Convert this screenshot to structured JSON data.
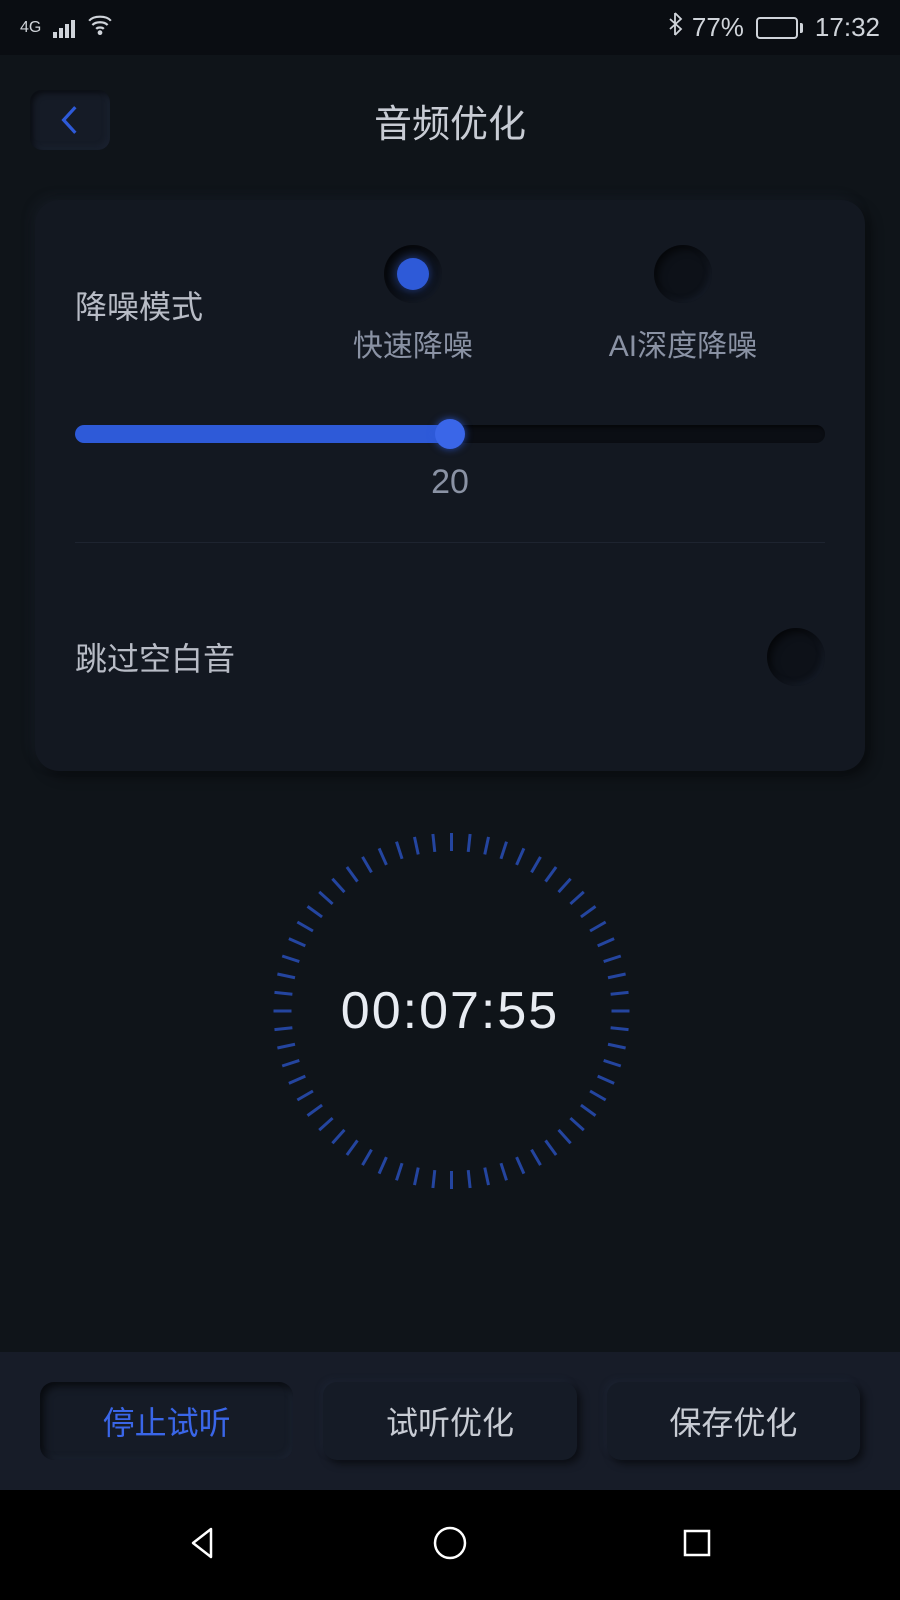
{
  "status": {
    "network": "4G",
    "battery_percent": "77%",
    "time": "17:32"
  },
  "header": {
    "title": "音频优化"
  },
  "noise_reduction": {
    "label": "降噪模式",
    "options": [
      {
        "label": "快速降噪",
        "selected": true
      },
      {
        "label": "AI深度降噪",
        "selected": false
      }
    ],
    "slider_value": "20",
    "slider_percent": 50
  },
  "skip_silence": {
    "label": "跳过空白音",
    "enabled": false
  },
  "timer": {
    "display": "00:07:55"
  },
  "toolbar": {
    "stop_preview": "停止试听",
    "preview_optimize": "试听优化",
    "save_optimize": "保存优化"
  }
}
